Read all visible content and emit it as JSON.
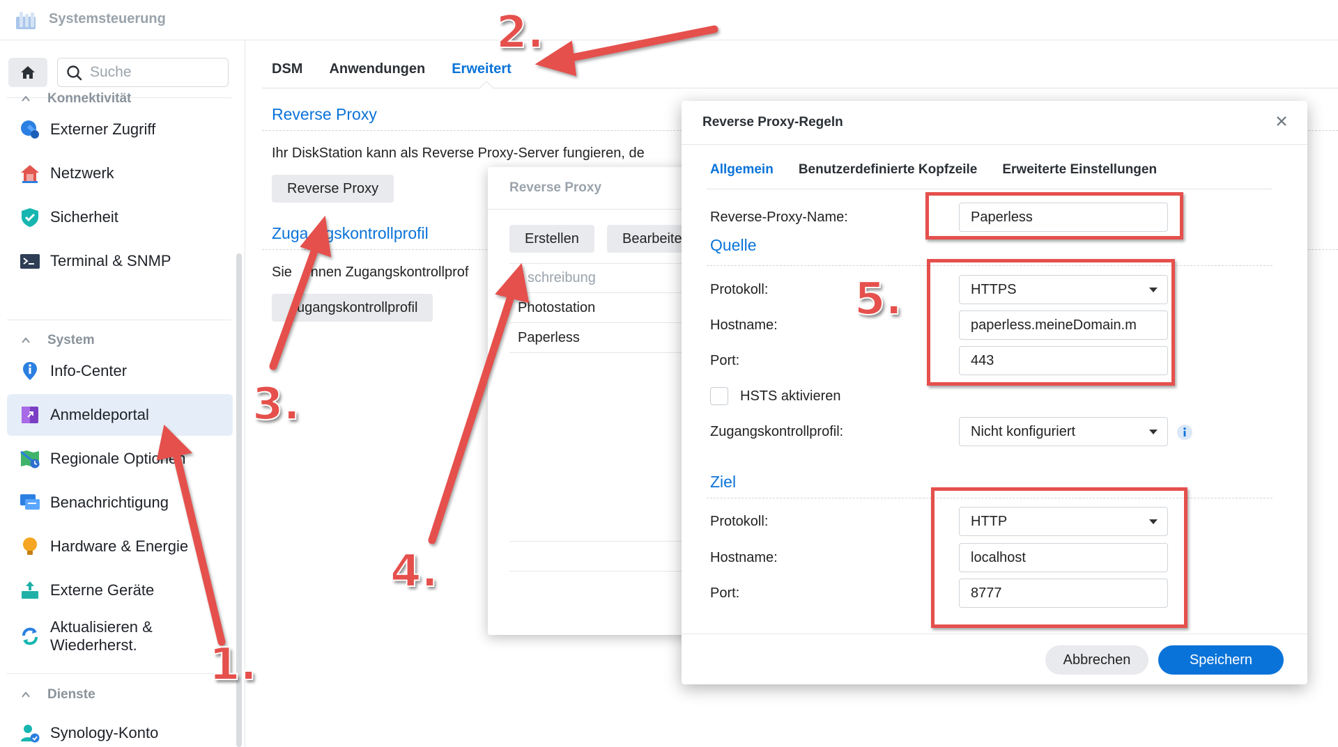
{
  "app": {
    "title": "Systemsteuerung"
  },
  "search": {
    "placeholder": "Suche"
  },
  "sidebar": {
    "sections": [
      {
        "title": "Konnektivität",
        "items": [
          {
            "label": "Externer Zugriff",
            "icon": "external-access-icon"
          },
          {
            "label": "Netzwerk",
            "icon": "network-house-icon"
          },
          {
            "label": "Sicherheit",
            "icon": "shield-check-icon"
          },
          {
            "label": "Terminal & SNMP",
            "icon": "terminal-icon"
          }
        ]
      },
      {
        "title": "System",
        "items": [
          {
            "label": "Info-Center",
            "icon": "info-pin-icon"
          },
          {
            "label": "Anmeldeportal",
            "icon": "login-portal-icon",
            "active": true
          },
          {
            "label": "Regionale Optionen",
            "icon": "regional-map-icon"
          },
          {
            "label": "Benachrichtigung",
            "icon": "chat-bubble-icon"
          },
          {
            "label": "Hardware & Energie",
            "icon": "lightbulb-icon"
          },
          {
            "label": "Externe Geräte",
            "icon": "external-device-icon"
          },
          {
            "label": "Aktualisieren &",
            "label2": "Wiederherst.",
            "icon": "update-arrows-icon"
          }
        ]
      },
      {
        "title": "Dienste",
        "items": [
          {
            "label": "Synology-Konto",
            "icon": "user-account-icon"
          }
        ]
      }
    ]
  },
  "tabs": [
    {
      "label": "DSM"
    },
    {
      "label": "Anwendungen"
    },
    {
      "label": "Erweitert",
      "active": true
    }
  ],
  "main": {
    "reverse_proxy_title": "Reverse Proxy",
    "reverse_proxy_desc": "Ihr DiskStation kann als Reverse Proxy-Server fungieren, de",
    "reverse_proxy_button": "Reverse Proxy",
    "access_profile_title_a": "Zuga",
    "access_profile_title_b": "gskontrollprofil",
    "access_profile_desc_a": "Sie ",
    "access_profile_desc_b": "onnen Zugangskontrollprof",
    "access_profile_button": "ugangskontrollprofil"
  },
  "mid_dialog": {
    "title": "Reverse Proxy",
    "create_button": "Erstellen",
    "edit_button": "Bearbeite",
    "column_header": "schreibung",
    "rows": [
      "Photostation",
      "Paperless"
    ]
  },
  "dialog": {
    "title": "Reverse Proxy-Regeln",
    "tabs": [
      "Allgemein",
      "Benutzerdefinierte Kopfzeile",
      "Erweiterte Einstellungen"
    ],
    "name_label": "Reverse-Proxy-Name:",
    "name_value": "Paperless",
    "source_title": "Quelle",
    "source_protocol_label": "Protokoll:",
    "source_protocol_value": "HTTPS",
    "source_hostname_label": "Hostname:",
    "source_hostname_value": "paperless.meineDomain.m",
    "source_port_label": "Port:",
    "source_port_value": "443",
    "hsts_label": "HSTS aktivieren",
    "hsts_checked": false,
    "access_label": "Zugangskontrollprofil:",
    "access_value": "Nicht konfiguriert",
    "target_title": "Ziel",
    "target_protocol_label": "Protokoll:",
    "target_protocol_value": "HTTP",
    "target_hostname_label": "Hostname:",
    "target_hostname_value": "localhost",
    "target_port_label": "Port:",
    "target_port_value": "8777",
    "cancel_button": "Abbrechen",
    "save_button": "Speichern"
  },
  "annotations": {
    "step1": "1.",
    "step2": "2.",
    "step3": "3.",
    "step4": "4.",
    "step5": "5."
  },
  "colors": {
    "accent": "#0a73d9",
    "annotation_red": "#e5504c",
    "active_item_bg": "#e5eef8"
  }
}
